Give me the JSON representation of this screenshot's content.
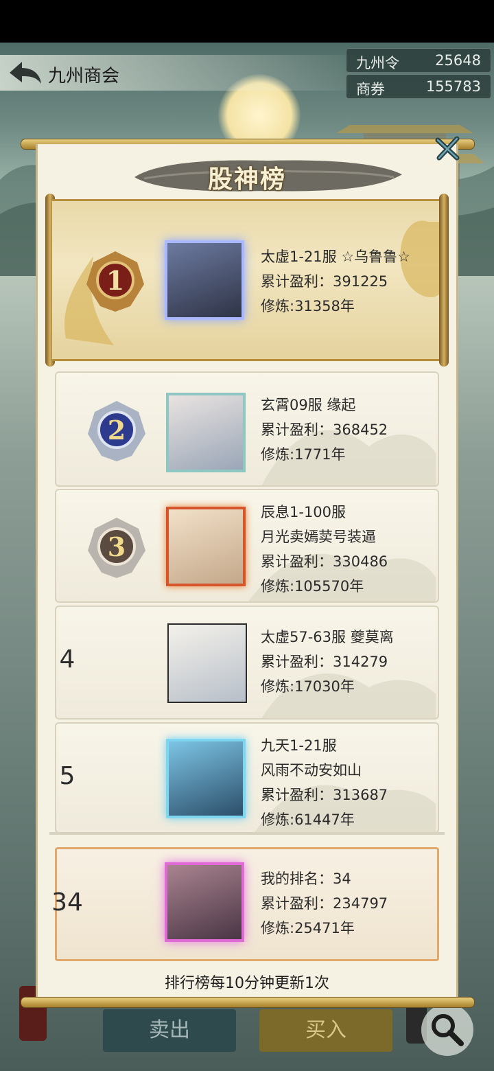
{
  "header": {
    "title": "九州商会"
  },
  "currencies": [
    {
      "label": "九州令",
      "value": "25648"
    },
    {
      "label": "商券",
      "value": "155783"
    }
  ],
  "modal": {
    "title": "股神榜",
    "footer": "排行榜每10分钟更新1次"
  },
  "rankings": [
    {
      "rank": "1",
      "server": "太虚1-21服 ☆乌鲁鲁☆",
      "profit": "累计盈利：391225",
      "cultivation": "修炼:31358年"
    },
    {
      "rank": "2",
      "server": "玄霄09服 缘起",
      "profit": "累计盈利：368452",
      "cultivation": "修炼:1771年"
    },
    {
      "rank": "3",
      "server": "辰息1-100服",
      "name2": "月光卖嫣荬号装逼",
      "profit": "累计盈利：330486",
      "cultivation": "修炼:105570年"
    },
    {
      "rank": "4",
      "server": "太虚57-63服 夔莫离",
      "profit": "累计盈利：314279",
      "cultivation": "修炼:17030年"
    },
    {
      "rank": "5",
      "server": "九天1-21服",
      "name2": "风雨不动安如山",
      "profit": "累计盈利：313687",
      "cultivation": "修炼:61447年"
    }
  ],
  "my_rank": {
    "rank": "34",
    "label": "我的排名：34",
    "profit": "累计盈利：234797",
    "cultivation": "修炼:25471年"
  },
  "bottom": {
    "sell": "卖出",
    "buy": "买入"
  },
  "colors": {
    "accent_gold": "#b58d3b",
    "my_rank_border": "#e2a86a",
    "sell_bg": "#2f4a4c",
    "buy_bg": "#7c6a2a"
  }
}
